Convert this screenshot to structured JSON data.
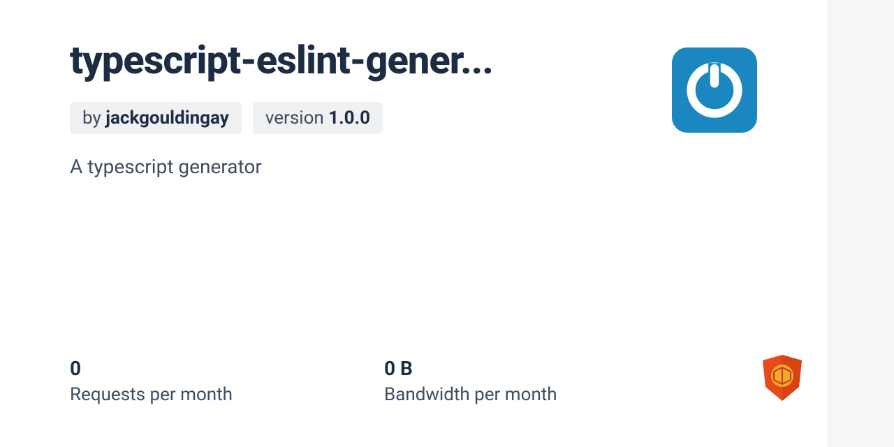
{
  "package": {
    "title": "typescript-eslint-gener...",
    "author_prefix": "by ",
    "author": "jackgouldingay",
    "version_prefix": "version ",
    "version": "1.0.0",
    "description": "A typescript generator"
  },
  "stats": {
    "requests": {
      "value": "0",
      "label": "Requests per month"
    },
    "bandwidth": {
      "value": "0 B",
      "label": "Bandwidth per month"
    }
  },
  "colors": {
    "avatar_bg": "#1b87c0",
    "shield": "#e64a19",
    "shield_inner": "#f9a825"
  }
}
